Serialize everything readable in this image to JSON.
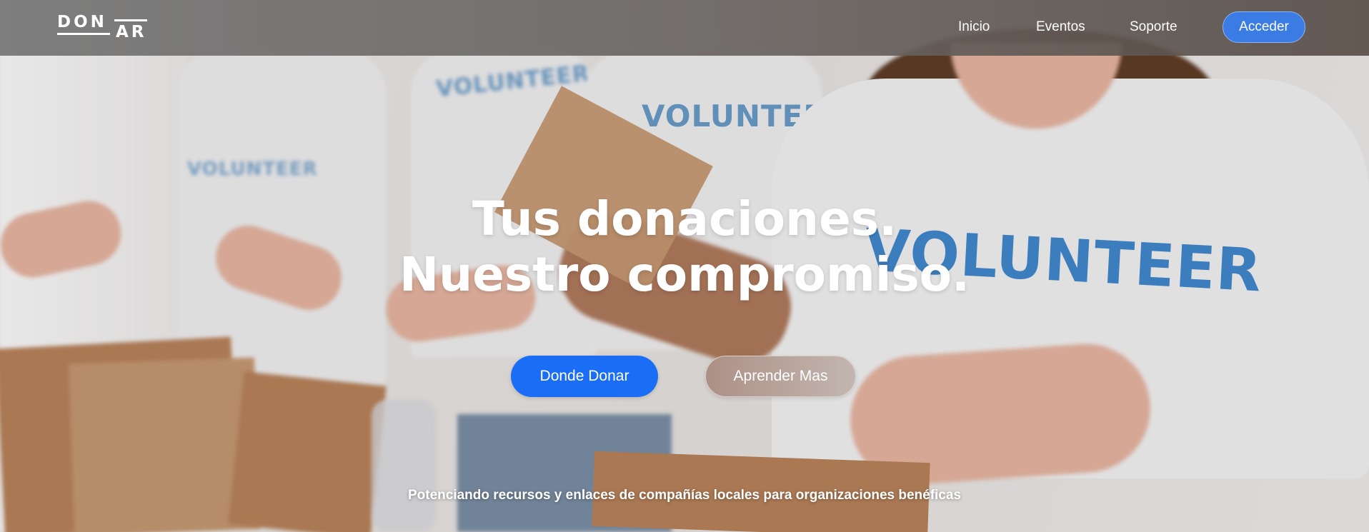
{
  "brand": {
    "logo_top": "DON",
    "logo_bottom": "AR"
  },
  "nav": {
    "items": [
      {
        "label": "Inicio"
      },
      {
        "label": "Eventos"
      },
      {
        "label": "Soporte"
      }
    ],
    "login_label": "Acceder"
  },
  "hero": {
    "headline_line1": "Tus donaciones.",
    "headline_line2": "Nuestro compromiso.",
    "primary_cta": "Donde Donar",
    "secondary_cta": "Aprender Mas",
    "tagline": "Potenciando recursos y enlaces de compañías locales para organizaciones benéficas",
    "shirt_prints": [
      "VOLUNTEER",
      "VOLUNTEER",
      "VOLUNTEER",
      "VOLUNTEER"
    ]
  },
  "colors": {
    "primary_blue": "#1a6ef5",
    "login_blue": "#3b7be4",
    "navbar": "#6f6b69"
  }
}
